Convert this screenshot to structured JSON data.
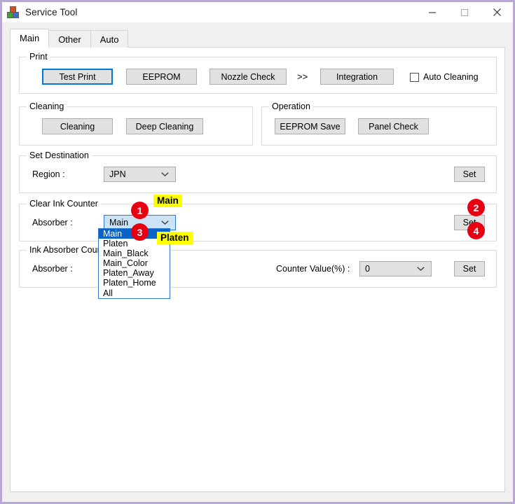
{
  "window": {
    "title": "Service Tool",
    "icon": "app-blocks-icon",
    "controls": {
      "minimize": "minimize-icon",
      "maximize": "maximize-icon",
      "close": "close-icon"
    },
    "border_color": "#b9a8d4"
  },
  "tabs": [
    {
      "label": "Main",
      "active": true
    },
    {
      "label": "Other",
      "active": false
    },
    {
      "label": "Auto",
      "active": false
    }
  ],
  "groups": {
    "print": {
      "title": "Print",
      "buttons": [
        {
          "label": "Test Print",
          "focused": true
        },
        {
          "label": "EEPROM",
          "focused": false
        },
        {
          "label": "Nozzle Check",
          "focused": false
        },
        {
          "label": "Integration",
          "focused": false
        }
      ],
      "separator": ">>",
      "checkbox": {
        "label": "Auto Cleaning",
        "checked": false
      }
    },
    "cleaning": {
      "title": "Cleaning",
      "buttons": [
        {
          "label": "Cleaning"
        },
        {
          "label": "Deep Cleaning"
        }
      ]
    },
    "operation": {
      "title": "Operation",
      "buttons": [
        {
          "label": "EEPROM Save"
        },
        {
          "label": "Panel Check"
        }
      ]
    },
    "set_destination": {
      "title": "Set Destination",
      "region_label": "Region :",
      "region_value": "JPN",
      "set_button": "Set"
    },
    "clear_ink_counter": {
      "title": "Clear Ink Counter",
      "absorber_label": "Absorber :",
      "absorber_value": "Main",
      "set_button": "Set",
      "dropdown_open": true,
      "options": [
        {
          "label": "Main",
          "selected": true
        },
        {
          "label": "Platen",
          "selected": false
        },
        {
          "label": "Main_Black",
          "selected": false
        },
        {
          "label": "Main_Color",
          "selected": false
        },
        {
          "label": "Platen_Away",
          "selected": false
        },
        {
          "label": "Platen_Home",
          "selected": false
        },
        {
          "label": "All",
          "selected": false
        }
      ]
    },
    "ink_absorber_counter": {
      "title": "Ink Absorber Counter",
      "absorber_label": "Absorber :",
      "counter_label": "Counter Value(%) :",
      "counter_value": "0",
      "set_button": "Set"
    }
  },
  "annotations": {
    "badges": [
      {
        "number": "1"
      },
      {
        "number": "2"
      },
      {
        "number": "3"
      },
      {
        "number": "4"
      }
    ],
    "highlights": [
      {
        "text": "Main"
      },
      {
        "text": "Platen"
      }
    ],
    "badge_color": "#e60012",
    "highlight_color": "#ffff00"
  }
}
